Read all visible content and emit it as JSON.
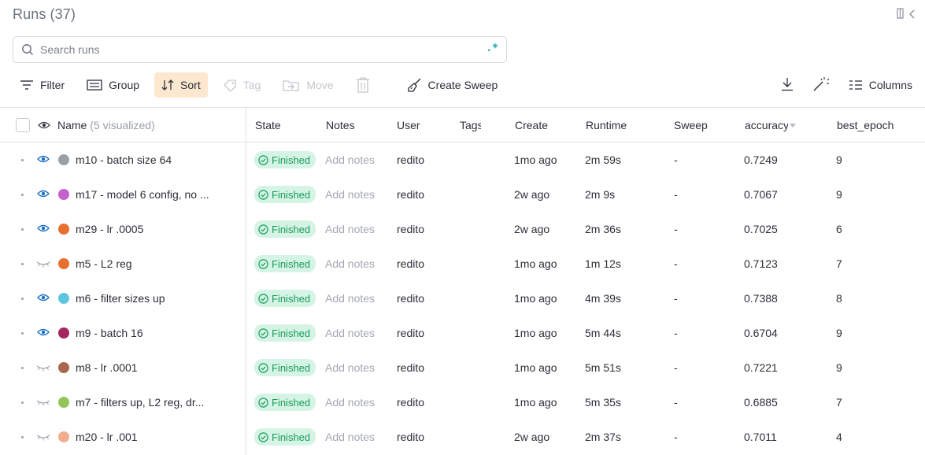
{
  "header": {
    "title": "Runs (37)"
  },
  "search": {
    "placeholder": "Search runs",
    "regex_label": ".*"
  },
  "toolbar": {
    "filter": "Filter",
    "group": "Group",
    "sort": "Sort",
    "tag": "Tag",
    "move": "Move",
    "create_sweep": "Create Sweep",
    "columns": "Columns"
  },
  "columns": {
    "name": "Name",
    "name_sub": "(5 visualized)",
    "state": "State",
    "notes": "Notes",
    "user": "User",
    "tags": "Tags",
    "create": "Create",
    "runtime": "Runtime",
    "sweep": "Sweep",
    "accuracy": "accuracy",
    "best_epoch": "best_epoch"
  },
  "rows": [
    {
      "visible": true,
      "color": "#9aa0a6",
      "name": "m10 - batch size 64",
      "state": "Finished",
      "notes": "Add notes",
      "user": "redito",
      "created": "1mo ago",
      "runtime": "2m 59s",
      "sweep": "-",
      "accuracy": "0.7249",
      "best_epoch": "9"
    },
    {
      "visible": true,
      "color": "#c660cf",
      "name": "m17 - model 6 config, no ...",
      "state": "Finished",
      "notes": "Add notes",
      "user": "redito",
      "created": "2w ago",
      "runtime": "2m 9s",
      "sweep": "-",
      "accuracy": "0.7067",
      "best_epoch": "9"
    },
    {
      "visible": true,
      "color": "#e8702f",
      "name": "m29 - lr .0005",
      "state": "Finished",
      "notes": "Add notes",
      "user": "redito",
      "created": "2w ago",
      "runtime": "2m 36s",
      "sweep": "-",
      "accuracy": "0.7025",
      "best_epoch": "6"
    },
    {
      "visible": false,
      "color": "#e8702f",
      "name": "m5 - L2 reg",
      "state": "Finished",
      "notes": "Add notes",
      "user": "redito",
      "created": "1mo ago",
      "runtime": "1m 12s",
      "sweep": "-",
      "accuracy": "0.7123",
      "best_epoch": "7"
    },
    {
      "visible": true,
      "color": "#5ec6e0",
      "name": "m6 - filter sizes up",
      "state": "Finished",
      "notes": "Add notes",
      "user": "redito",
      "created": "1mo ago",
      "runtime": "4m 39s",
      "sweep": "-",
      "accuracy": "0.7388",
      "best_epoch": "8"
    },
    {
      "visible": true,
      "color": "#a3245e",
      "name": "m9 - batch 16",
      "state": "Finished",
      "notes": "Add notes",
      "user": "redito",
      "created": "1mo ago",
      "runtime": "5m 44s",
      "sweep": "-",
      "accuracy": "0.6704",
      "best_epoch": "9"
    },
    {
      "visible": false,
      "color": "#a9674f",
      "name": "m8 - lr .0001",
      "state": "Finished",
      "notes": "Add notes",
      "user": "redito",
      "created": "1mo ago",
      "runtime": "5m 51s",
      "sweep": "-",
      "accuracy": "0.7221",
      "best_epoch": "9"
    },
    {
      "visible": false,
      "color": "#93c55a",
      "name": "m7 - filters up, L2 reg, dr...",
      "state": "Finished",
      "notes": "Add notes",
      "user": "redito",
      "created": "1mo ago",
      "runtime": "5m 35s",
      "sweep": "-",
      "accuracy": "0.6885",
      "best_epoch": "7"
    },
    {
      "visible": false,
      "color": "#f2ad8e",
      "name": "m20 - lr .001",
      "state": "Finished",
      "notes": "Add notes",
      "user": "redito",
      "created": "2w ago",
      "runtime": "2m 37s",
      "sweep": "-",
      "accuracy": "0.7011",
      "best_epoch": "4"
    }
  ]
}
